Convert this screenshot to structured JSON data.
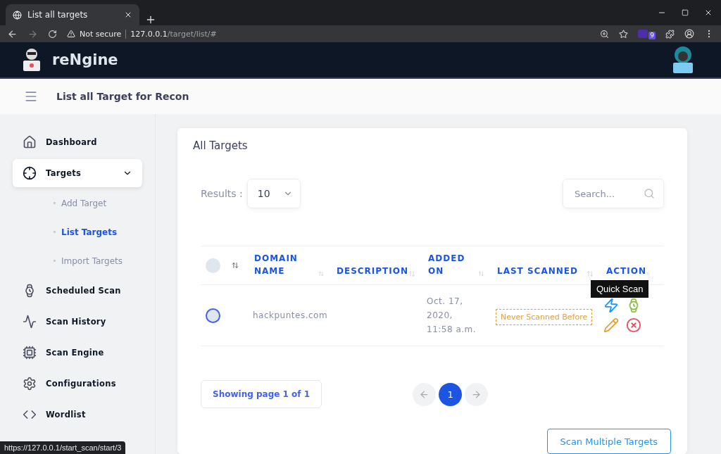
{
  "browser": {
    "tab_title": "List all targets",
    "security": "Not secure",
    "url_host": "127.0.0.1",
    "url_path": "/target/list/#",
    "extension_badge": "9"
  },
  "app": {
    "name": "reNgine",
    "page_title": "List all Target for Recon"
  },
  "sidebar": {
    "items": [
      {
        "label": "Dashboard",
        "kind": "home",
        "selected": false
      },
      {
        "label": "Targets",
        "kind": "target",
        "expanded": true,
        "selected": true,
        "children": [
          {
            "label": "Add Target",
            "selected": false
          },
          {
            "label": "List Targets",
            "selected": true
          },
          {
            "label": "Import Targets",
            "selected": false
          }
        ]
      },
      {
        "label": "Scheduled Scan",
        "kind": "watch",
        "selected": false
      },
      {
        "label": "Scan History",
        "kind": "activity",
        "selected": false
      },
      {
        "label": "Scan Engine",
        "kind": "cpu",
        "selected": false
      },
      {
        "label": "Configurations",
        "kind": "gear",
        "selected": false
      },
      {
        "label": "Wordlist",
        "kind": "code",
        "selected": false
      }
    ]
  },
  "card": {
    "title": "All Targets",
    "results_label": "Results :",
    "results_value": "10",
    "search_placeholder": "Search...",
    "table": {
      "all_selected": false,
      "columns": [
        {
          "label": "DOMAIN NAME"
        },
        {
          "label": "DESCRIPTION"
        },
        {
          "label": "ADDED ON"
        },
        {
          "label": "LAST SCANNED"
        },
        {
          "label": "ACTION"
        }
      ],
      "rows": [
        {
          "selected": false,
          "domain": "hackpuntes.com",
          "added_on": [
            "Oct. 17,",
            "2020,",
            "11:58 a.m."
          ],
          "last_scanned": "Never Scanned Before"
        }
      ]
    },
    "tooltip": "Quick Scan",
    "page_info": "Showing page 1 of 1",
    "pages": [
      {
        "label": "1",
        "selected": true
      }
    ],
    "scan_button": "Scan Multiple Targets"
  },
  "status_url": "https://127.0.0.1/start_scan/start/3"
}
